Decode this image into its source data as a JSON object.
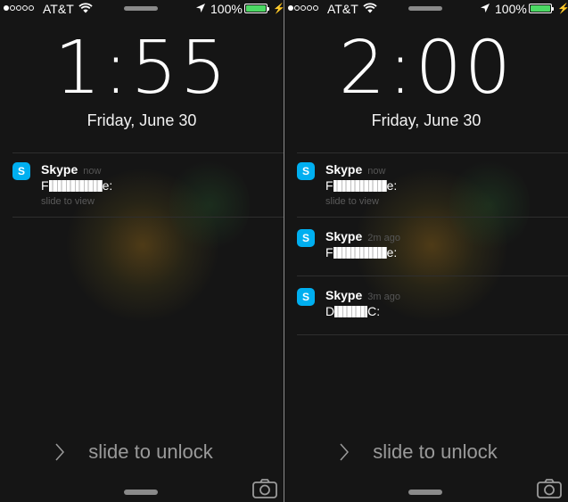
{
  "screens": [
    {
      "status": {
        "carrier": "AT&T",
        "battery_pct": "100%"
      },
      "time": "1:55",
      "date": "Friday, June 30",
      "notifications": [
        {
          "app": "Skype",
          "when": "now",
          "msg_start": "F",
          "msg_end": "e:",
          "hint": "slide to view"
        }
      ],
      "unlock_label": "slide to unlock"
    },
    {
      "status": {
        "carrier": "AT&T",
        "battery_pct": "100%"
      },
      "time": "2:00",
      "date": "Friday, June 30",
      "notifications": [
        {
          "app": "Skype",
          "when": "now",
          "msg_start": "F",
          "msg_end": "e:",
          "hint": "slide to view"
        },
        {
          "app": "Skype",
          "when": "2m ago",
          "msg_start": "F",
          "msg_end": "e:"
        },
        {
          "app": "Skype",
          "when": "3m ago",
          "msg_start": "D",
          "msg_end": "C:"
        }
      ],
      "unlock_label": "slide to unlock"
    }
  ],
  "colors": {
    "battery": "#4cd964",
    "skype": "#00aff0"
  },
  "icons": [
    "location-arrow-icon",
    "wifi-icon",
    "skype-icon",
    "camera-icon",
    "chevron-right-icon",
    "charging-bolt-icon"
  ]
}
